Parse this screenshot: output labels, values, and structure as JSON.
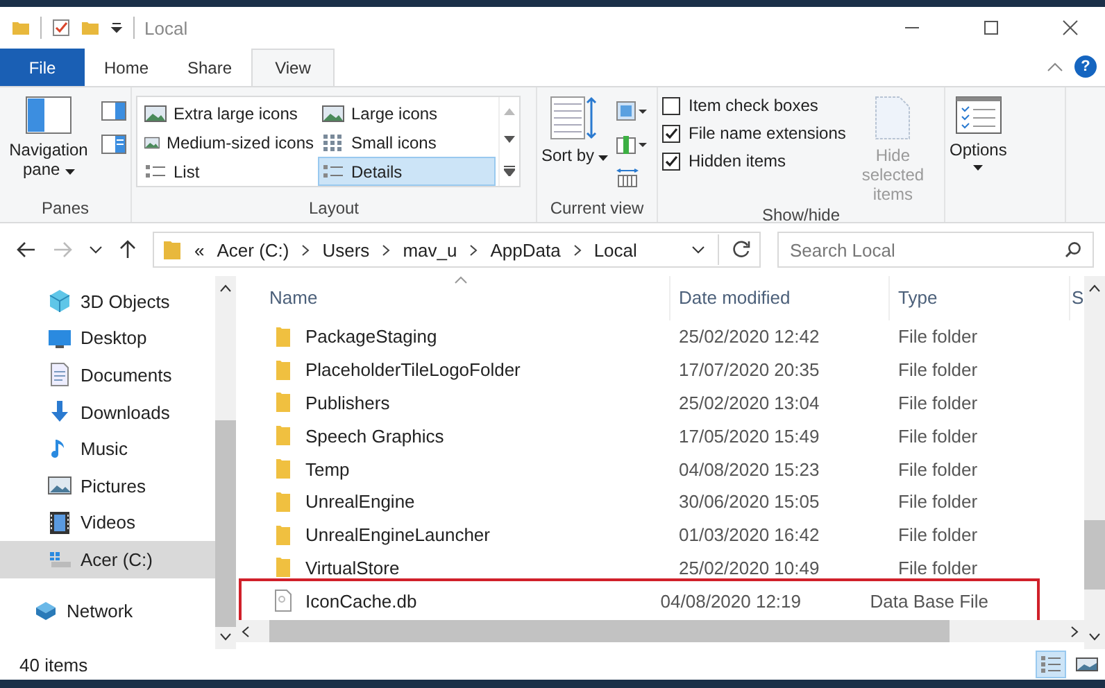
{
  "window": {
    "title": "Local"
  },
  "ribbon_tabs": [
    {
      "label": "File",
      "kind": "file",
      "selected": false
    },
    {
      "label": "Home",
      "kind": "tab",
      "selected": false
    },
    {
      "label": "Share",
      "kind": "tab",
      "selected": false
    },
    {
      "label": "View",
      "kind": "tab",
      "selected": true
    }
  ],
  "help_label": "?",
  "ribbon": {
    "panes": {
      "label": "Panes",
      "navigation_pane": "Navigation pane"
    },
    "layout": {
      "label": "Layout",
      "options": [
        {
          "label": "Extra large icons",
          "kind": "xl",
          "selected": false
        },
        {
          "label": "Large icons",
          "kind": "large",
          "selected": false
        },
        {
          "label": "Medium-sized icons",
          "kind": "medium",
          "selected": false
        },
        {
          "label": "Small icons",
          "kind": "small",
          "selected": false
        },
        {
          "label": "List",
          "kind": "list",
          "selected": false
        },
        {
          "label": "Details",
          "kind": "details",
          "selected": true
        }
      ]
    },
    "current_view": {
      "label": "Current view",
      "sort_by": "Sort by"
    },
    "show_hide": {
      "label": "Show/hide",
      "checkboxes": [
        {
          "label": "Item check boxes",
          "checked": false
        },
        {
          "label": "File name extensions",
          "checked": true
        },
        {
          "label": "Hidden items",
          "checked": true
        }
      ],
      "hide_selected": {
        "label": "Hide selected items",
        "disabled": true
      }
    },
    "options": {
      "label": "Options"
    }
  },
  "address": {
    "prefix": "«",
    "segments": [
      "Acer (C:)",
      "Users",
      "mav_u",
      "AppData",
      "Local"
    ],
    "search_placeholder": "Search Local"
  },
  "sidebar": {
    "items": [
      {
        "label": "3D Objects",
        "kind": "objects3d",
        "selected": false
      },
      {
        "label": "Desktop",
        "kind": "desktop",
        "selected": false
      },
      {
        "label": "Documents",
        "kind": "documents",
        "selected": false
      },
      {
        "label": "Downloads",
        "kind": "downloads",
        "selected": false
      },
      {
        "label": "Music",
        "kind": "music",
        "selected": false
      },
      {
        "label": "Pictures",
        "kind": "pictures",
        "selected": false
      },
      {
        "label": "Videos",
        "kind": "videos",
        "selected": false
      },
      {
        "label": "Acer (C:)",
        "kind": "drive",
        "selected": true
      },
      {
        "label": "Network",
        "kind": "network",
        "selected": false
      }
    ]
  },
  "table": {
    "columns": [
      "Name",
      "Date modified",
      "Type",
      "S"
    ],
    "rows": [
      {
        "name": "PackageStaging",
        "date": "25/02/2020 12:42",
        "type": "File folder",
        "kind": "folder",
        "highlighted": false
      },
      {
        "name": "PlaceholderTileLogoFolder",
        "date": "17/07/2020 20:35",
        "type": "File folder",
        "kind": "folder",
        "highlighted": false
      },
      {
        "name": "Publishers",
        "date": "25/02/2020 13:04",
        "type": "File folder",
        "kind": "folder",
        "highlighted": false
      },
      {
        "name": "Speech Graphics",
        "date": "17/05/2020 15:49",
        "type": "File folder",
        "kind": "folder",
        "highlighted": false
      },
      {
        "name": "Temp",
        "date": "04/08/2020 15:23",
        "type": "File folder",
        "kind": "folder",
        "highlighted": false
      },
      {
        "name": "UnrealEngine",
        "date": "30/06/2020 15:05",
        "type": "File folder",
        "kind": "folder",
        "highlighted": false
      },
      {
        "name": "UnrealEngineLauncher",
        "date": "01/03/2020 16:42",
        "type": "File folder",
        "kind": "folder",
        "highlighted": false
      },
      {
        "name": "VirtualStore",
        "date": "25/02/2020 10:49",
        "type": "File folder",
        "kind": "folder",
        "highlighted": false
      },
      {
        "name": "IconCache.db",
        "date": "04/08/2020 12:19",
        "type": "Data Base File",
        "kind": "file",
        "highlighted": true
      }
    ]
  },
  "status_bar": {
    "count": "40 items",
    "views": [
      {
        "kind": "details",
        "selected": true
      },
      {
        "kind": "large",
        "selected": false
      }
    ]
  }
}
